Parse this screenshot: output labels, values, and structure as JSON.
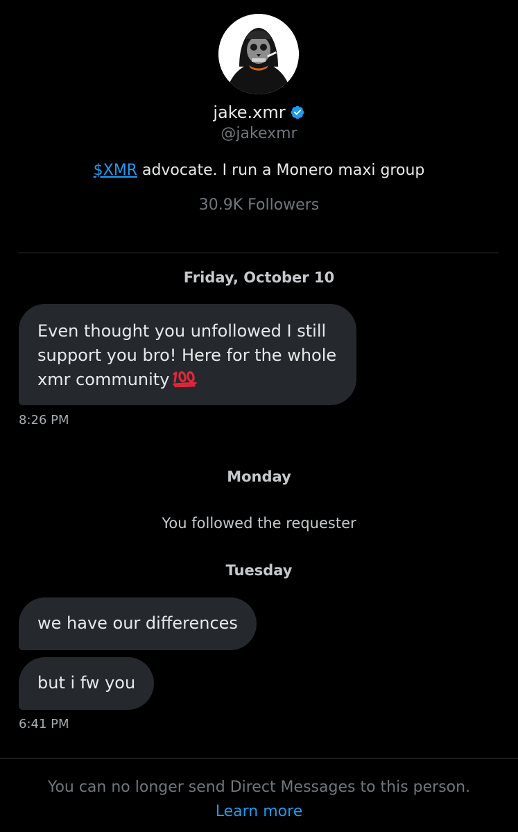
{
  "profile": {
    "display_name": "jake.xmr",
    "handle": "@jakexmr",
    "bio_cashtag": "$XMR",
    "bio_text": " advocate. I run a Monero maxi group",
    "followers": "30.9K Followers",
    "verified_icon": "verified-badge-icon"
  },
  "conversation": {
    "day1_label": "Friday, October 10",
    "msg1_text": "Even thought you unfollowed I still support you bro! Here for the whole xmr community",
    "msg1_emoji": "hundred-points-icon",
    "msg1_time": "8:26 PM",
    "day2_label": "Monday",
    "system_event": "You followed the requester",
    "day3_label": "Tuesday",
    "msg2_text": "we have our differences",
    "msg3_text": "but i fw you",
    "msg3_time": "6:41 PM"
  },
  "footer": {
    "notice": "You can no longer send Direct Messages to this person. ",
    "learn_more": "Learn more"
  },
  "colors": {
    "background": "#000000",
    "bubble": "#25292e",
    "accent": "#1d9bf0",
    "muted": "#71767b"
  }
}
